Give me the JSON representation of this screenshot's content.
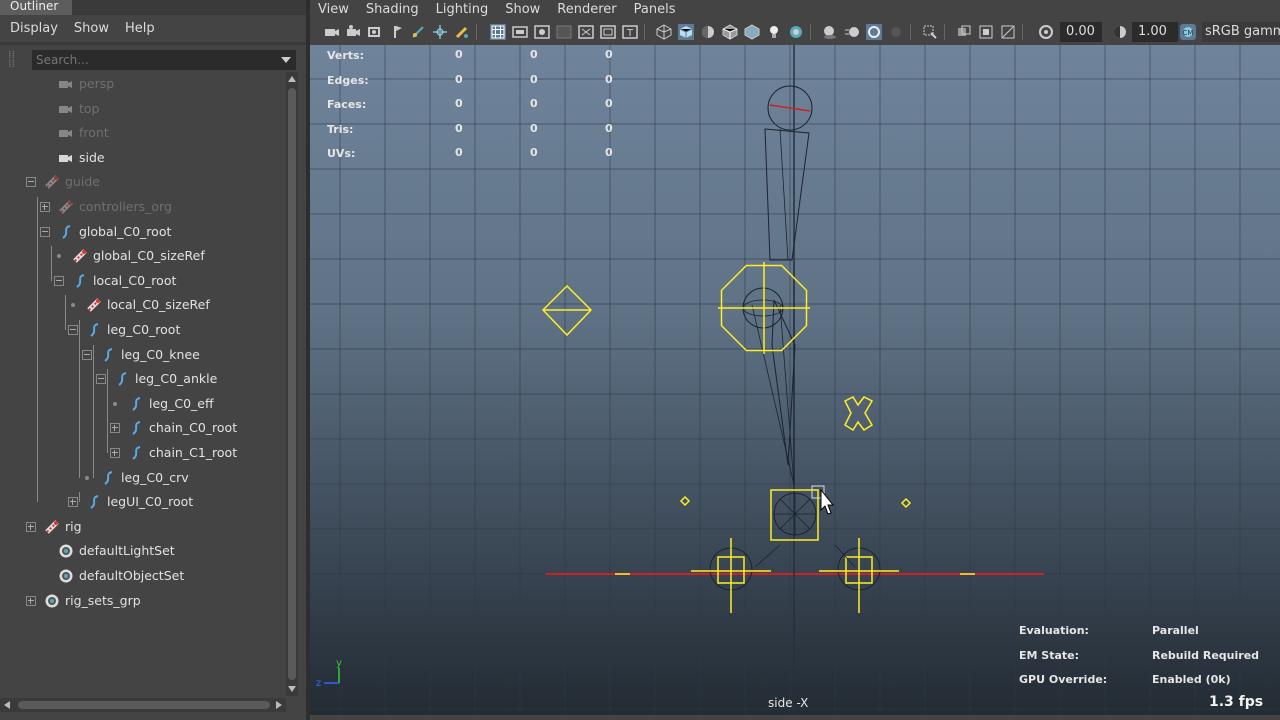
{
  "outliner": {
    "title": "Outliner",
    "menu": [
      "Display",
      "Show",
      "Help"
    ],
    "search_placeholder": "Search...",
    "nodes": [
      {
        "label": "persp",
        "icon": "camera-icon",
        "dim": true
      },
      {
        "label": "top",
        "icon": "camera-icon",
        "dim": true
      },
      {
        "label": "front",
        "icon": "camera-icon",
        "dim": true
      },
      {
        "label": "side",
        "icon": "camera-icon",
        "dim": false
      },
      {
        "label": "guide",
        "icon": "transform-icon",
        "dim": true,
        "expander": "minus"
      },
      {
        "label": "controllers_org",
        "icon": "transform-icon",
        "dim": true,
        "expander": "plus"
      },
      {
        "label": "global_C0_root",
        "icon": "curve-icon",
        "dim": false,
        "expander": "minus"
      },
      {
        "label": "global_C0_sizeRef",
        "icon": "transform-icon",
        "dim": false
      },
      {
        "label": "local_C0_root",
        "icon": "curve-icon",
        "dim": false,
        "expander": "minus"
      },
      {
        "label": "local_C0_sizeRef",
        "icon": "transform-icon",
        "dim": false
      },
      {
        "label": "leg_C0_root",
        "icon": "curve-icon",
        "dim": false,
        "expander": "minus"
      },
      {
        "label": "leg_C0_knee",
        "icon": "curve-icon",
        "dim": false,
        "expander": "minus"
      },
      {
        "label": "leg_C0_ankle",
        "icon": "curve-icon",
        "dim": false,
        "expander": "minus"
      },
      {
        "label": "leg_C0_eff",
        "icon": "curve-icon",
        "dim": false
      },
      {
        "label": "chain_C0_root",
        "icon": "curve-icon",
        "dim": false,
        "expander": "plus"
      },
      {
        "label": "chain_C1_root",
        "icon": "curve-icon",
        "dim": false,
        "expander": "plus"
      },
      {
        "label": "leg_C0_crv",
        "icon": "curve-icon",
        "dim": false
      },
      {
        "label": "legUI_C0_root",
        "icon": "curve-icon",
        "dim": false,
        "expander": "plus"
      },
      {
        "label": "rig",
        "icon": "transform-icon",
        "dim": false,
        "expander": "plus"
      },
      {
        "label": "defaultLightSet",
        "icon": "set-icon",
        "dim": false
      },
      {
        "label": "defaultObjectSet",
        "icon": "set-icon",
        "dim": false
      },
      {
        "label": "rig_sets_grp",
        "icon": "set-icon",
        "dim": false,
        "expander": "plus"
      }
    ]
  },
  "viewport": {
    "menu": [
      "View",
      "Shading",
      "Lighting",
      "Show",
      "Renderer",
      "Panels"
    ],
    "exposure": "0.00",
    "gamma": "1.00",
    "colorspace": "sRGB gamma",
    "hud_stats": {
      "labels": [
        "Verts:",
        "Edges:",
        "Faces:",
        "Tris:",
        "UVs:"
      ],
      "values": [
        [
          "0",
          "0",
          "0"
        ],
        [
          "0",
          "0",
          "0"
        ],
        [
          "0",
          "0",
          "0"
        ],
        [
          "0",
          "0",
          "0"
        ],
        [
          "0",
          "0",
          "0"
        ]
      ]
    },
    "hud_status": [
      {
        "label": "Evaluation:",
        "value": "Parallel"
      },
      {
        "label": "EM State:",
        "value": "Rebuild Required"
      },
      {
        "label": "GPU Override:",
        "value": "Enabled (0k)"
      }
    ],
    "camera": "side -X",
    "fps": "1.3 fps",
    "axis_labels": {
      "y": "y",
      "z": "z"
    },
    "colors": {
      "guide": "#ffee22",
      "grid_axis": "#cc2222",
      "wire": "#1b2330"
    }
  }
}
